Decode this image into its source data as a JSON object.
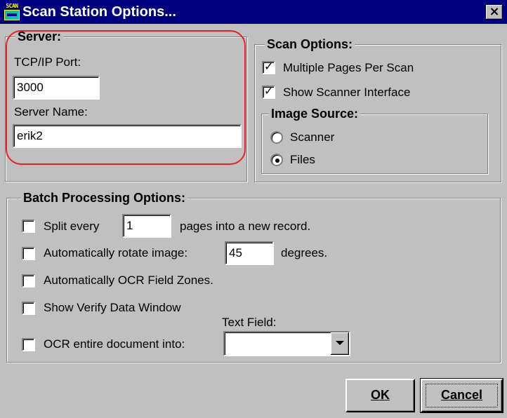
{
  "window": {
    "title": "Scan Station Options...",
    "close_glyph": "×",
    "icon": {
      "name": "scan-app-icon",
      "text": "SCAN"
    }
  },
  "server": {
    "legend": "Server:",
    "tcp_label": "TCP/IP Port:",
    "tcp_value": "3000",
    "name_label": "Server Name:",
    "name_value": "erik2"
  },
  "scan_options": {
    "legend": "Scan Options:",
    "multiple_pages": {
      "label": "Multiple Pages Per Scan",
      "checked": true
    },
    "show_interface": {
      "label": "Show Scanner Interface",
      "checked": true
    },
    "image_source": {
      "legend": "Image Source:",
      "scanner": {
        "label": "Scanner",
        "selected": false
      },
      "files": {
        "label": "Files",
        "selected": true
      }
    }
  },
  "batch": {
    "legend": "Batch Processing Options:",
    "split": {
      "before": "Split every",
      "value": "1",
      "after": "pages into a new record.",
      "checked": false
    },
    "rotate": {
      "before": "Automatically rotate image:",
      "value": "45",
      "after": "degrees.",
      "checked": false
    },
    "ocr_zones": {
      "label": "Automatically OCR Field Zones.",
      "checked": false
    },
    "verify": {
      "label": "Show Verify Data Window",
      "checked": false
    },
    "ocr_entire": {
      "label": "OCR entire document into:",
      "field_label": "Text Field:",
      "selected": "",
      "checked": false
    }
  },
  "buttons": {
    "ok": "OK",
    "cancel": "Cancel"
  },
  "colors": {
    "face": "#c0c0c0",
    "titlebar": "#000080",
    "annotation": "#e8202a"
  }
}
